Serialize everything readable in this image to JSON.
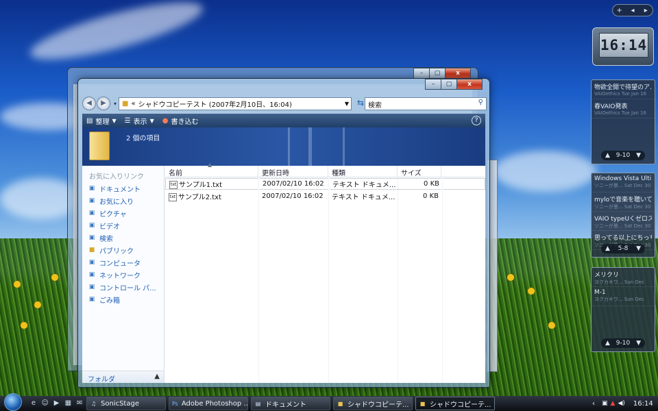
{
  "address": {
    "chevron": "«",
    "path": "シャドウコピーテスト (2007年2月10日、16:04)"
  },
  "search": {
    "placeholder": "検索"
  },
  "toolbar": {
    "organize": "整理",
    "views": "表示",
    "burn": "書き込む",
    "help": "?"
  },
  "info": {
    "item_count": "2 個の項目"
  },
  "sidebar_pane": {
    "title": "お気に入りリンク",
    "items": [
      {
        "label": "ドキュメント",
        "icon": "documents-icon"
      },
      {
        "label": "お気に入り",
        "icon": "favorites-icon"
      },
      {
        "label": "ピクチャ",
        "icon": "pictures-icon"
      },
      {
        "label": "ビデオ",
        "icon": "videos-icon"
      },
      {
        "label": "検索",
        "icon": "search-folder-icon"
      },
      {
        "label": "パブリック",
        "icon": "public-folder-icon"
      },
      {
        "label": "コンピュータ",
        "icon": "computer-icon"
      },
      {
        "label": "ネットワーク",
        "icon": "network-icon"
      },
      {
        "label": "コントロール パ...",
        "icon": "control-panel-icon"
      },
      {
        "label": "ごみ箱",
        "icon": "recycle-bin-icon"
      }
    ],
    "footer": "フォルダ"
  },
  "columns": [
    "名前",
    "更新日時",
    "種類",
    "サイズ"
  ],
  "files": [
    {
      "name": "サンプル1.txt",
      "modified": "2007/02/10 16:02",
      "type": "テキスト ドキュメ...",
      "size": "0 KB"
    },
    {
      "name": "サンプル2.txt",
      "modified": "2007/02/10 16:02",
      "type": "テキスト ドキュメ...",
      "size": "0 KB"
    }
  ],
  "gadgets": {
    "top_bar": {
      "add": "+",
      "prev": "◂",
      "next": "▸"
    },
    "clock": "16:14",
    "feed1": {
      "items": [
        {
          "title": "物欲全開で待望のア...",
          "meta": "VAIOethics  Tue Jan 16"
        },
        {
          "title": "春VAIO発表",
          "meta": "VAIOethics  Tue Jan 16"
        }
      ],
      "pager": "9-10"
    },
    "feed2": {
      "items": [
        {
          "title": "Windows Vista Ultim...",
          "meta": "ソニーが景...  Sat Dec 30"
        },
        {
          "title": "myloで音楽を聴いて...",
          "meta": "ソニーが景...  Sat Dec 30"
        },
        {
          "title": "VAIO typeUくゼロス...",
          "meta": "ソニーが景...  Sat Dec 30"
        },
        {
          "title": "思ってる以上にちっちゃ...",
          "meta": "ソニーが景...  Sat Dec 30"
        }
      ],
      "pager": "5-8"
    },
    "feed3": {
      "items": [
        {
          "title": "メリクリ",
          "meta": "ヨクカキワ...  Sun Dec"
        },
        {
          "title": "M-1",
          "meta": "ヨクカキワ...  Sun Dec"
        }
      ],
      "pager": "9-10"
    }
  },
  "taskbar": {
    "tasks": [
      {
        "label": "SonicStage",
        "icon": "sonicstage-icon",
        "active": false
      },
      {
        "label": "Adobe Photoshop ...",
        "icon": "photoshop-icon",
        "active": false
      },
      {
        "label": "ドキュメント",
        "icon": "documents-icon",
        "active": false
      },
      {
        "label": "シャドウコピーテ...",
        "icon": "folder-icon",
        "active": false
      },
      {
        "label": "シャドウコピーテ...",
        "icon": "folder-icon",
        "active": true
      }
    ],
    "clock": "16:14"
  },
  "colors": {
    "accent": "#1f5fb5",
    "toolbar": "#2b4b78",
    "infopane": "#1d4289",
    "close": "#c4341c"
  }
}
